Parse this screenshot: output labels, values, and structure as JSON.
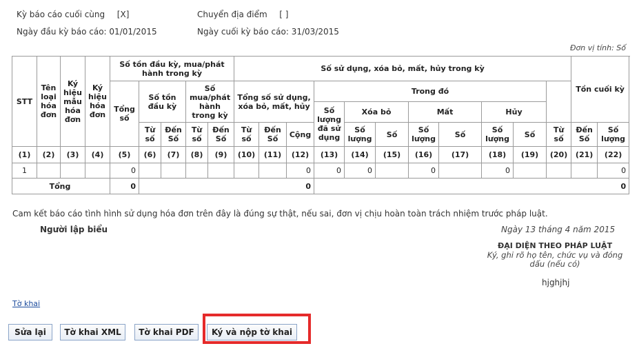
{
  "header": {
    "last_period_label": "Kỳ báo cáo cuối cùng",
    "last_period_value": "[X]",
    "relocation_label": "Chuyển địa điểm",
    "relocation_value": "[ ]",
    "start_date_label": "Ngày đầu kỳ báo cáo:",
    "start_date_value": "01/01/2015",
    "end_date_label": "Ngày cuối kỳ báo cáo:",
    "end_date_value": "31/03/2015",
    "unit": "Đơn vị tính: Số"
  },
  "table": {
    "h_stt": "STT",
    "h_type": "Tên loại hóa đơn",
    "h_form": "Ký hiệu mẫu hóa đơn",
    "h_symbol": "Ký hiệu hóa đơn",
    "h_opening_group": "Số tồn đầu kỳ, mua/phát hành trong kỳ",
    "h_total": "Tổng số",
    "h_opening": "Số tồn đầu kỳ",
    "h_purchased": "Số mua/phát hành trong kỳ",
    "h_used_group": "Số sử dụng, xóa bỏ, mất, hủy trong kỳ",
    "h_used_total": "Tổng số sử dụng, xóa bỏ, mất, hủy",
    "h_of_which": "Trong đó",
    "h_used_qty": "Số lượng đã sử dụng",
    "h_deleted": "Xóa bỏ",
    "h_lost": "Mất",
    "h_cancelled": "Hủy",
    "h_closing": "Tồn cuối kỳ",
    "h_from": "Từ số",
    "h_to": "Đến Số",
    "h_sum": "Cộng",
    "h_qty": "Số lượng",
    "h_numbers": "Số",
    "col_numbers": [
      "(1)",
      "(2)",
      "(3)",
      "(4)",
      "(5)",
      "(6)",
      "(7)",
      "(8)",
      "(9)",
      "(10)",
      "(11)",
      "(12)",
      "(13)",
      "(14)",
      "(15)",
      "(16)",
      "(17)",
      "(18)",
      "(19)",
      "(20)",
      "(21)",
      "(22)"
    ],
    "row1": [
      "1",
      "",
      "",
      "",
      "0",
      "",
      "",
      "",
      "",
      "",
      "",
      "0",
      "0",
      "0",
      "",
      "0",
      "",
      "0",
      "",
      "",
      "",
      "0"
    ],
    "total_label": "Tổng",
    "total_opening": "0",
    "total_used": "0",
    "total_closing": "0"
  },
  "commitment": "Cam kết báo cáo tình hình sử dụng hóa đơn trên đây là đúng sự thật, nếu sai, đơn vị chịu hoàn toàn trách nhiệm trước pháp luật.",
  "signature": {
    "preparer_label": "Người lập biểu",
    "date_text": "Ngày 13 tháng 4 năm 2015",
    "representative_label": "ĐẠI DIỆN THEO PHÁP LUẬT",
    "instruction": "Ký, ghi rõ họ tên, chức vụ và đóng dấu (nếu có)",
    "signer_name": "hjghjhj"
  },
  "footer": {
    "link_label": "Tờ khai",
    "buttons": {
      "edit": "Sửa lại",
      "xml": "Tờ khai XML",
      "pdf": "Tờ khai PDF",
      "sign_submit": "Ký và nộp tờ khai"
    }
  }
}
